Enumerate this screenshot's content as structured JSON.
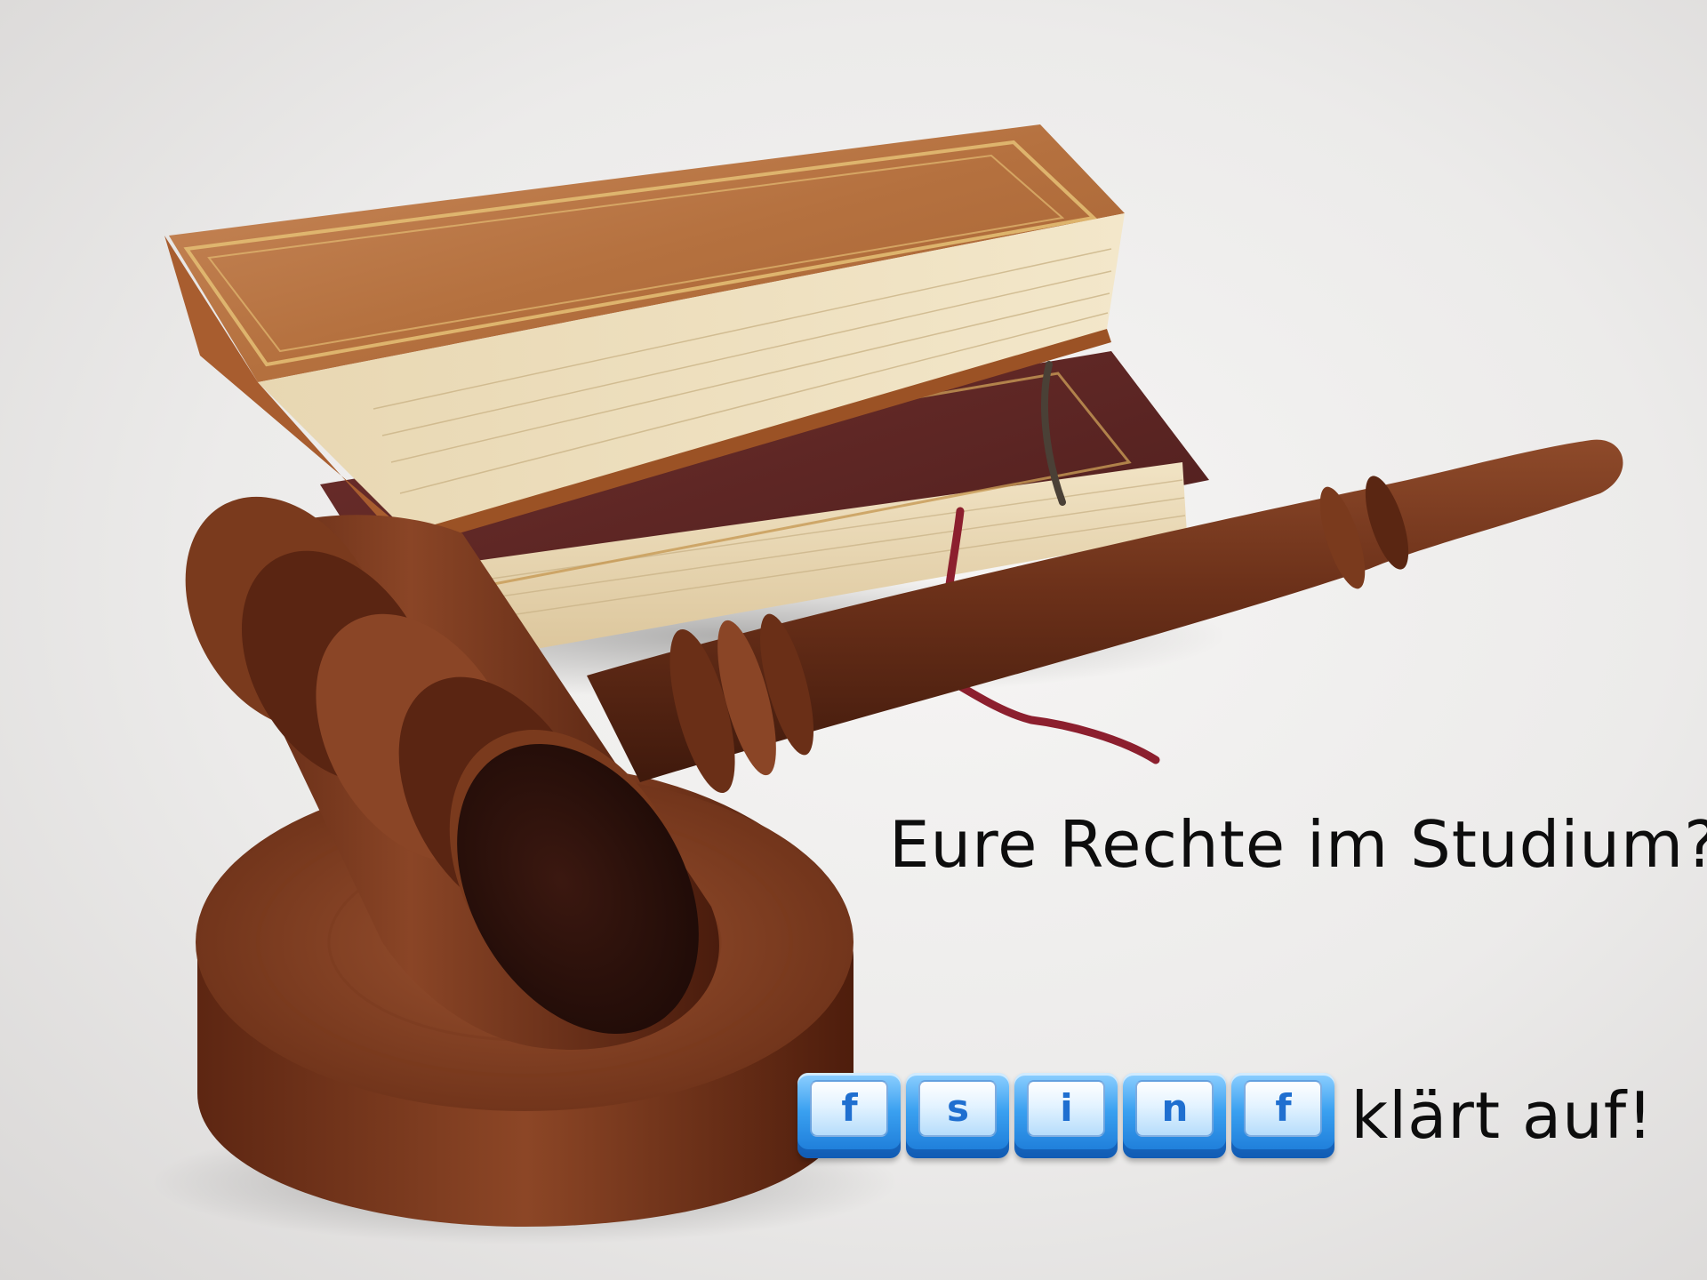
{
  "headline": "Eure Rechte im Studium?",
  "brand": {
    "keys": [
      "f",
      "s",
      "i",
      "n",
      "f"
    ],
    "tagline": "klärt auf!"
  }
}
